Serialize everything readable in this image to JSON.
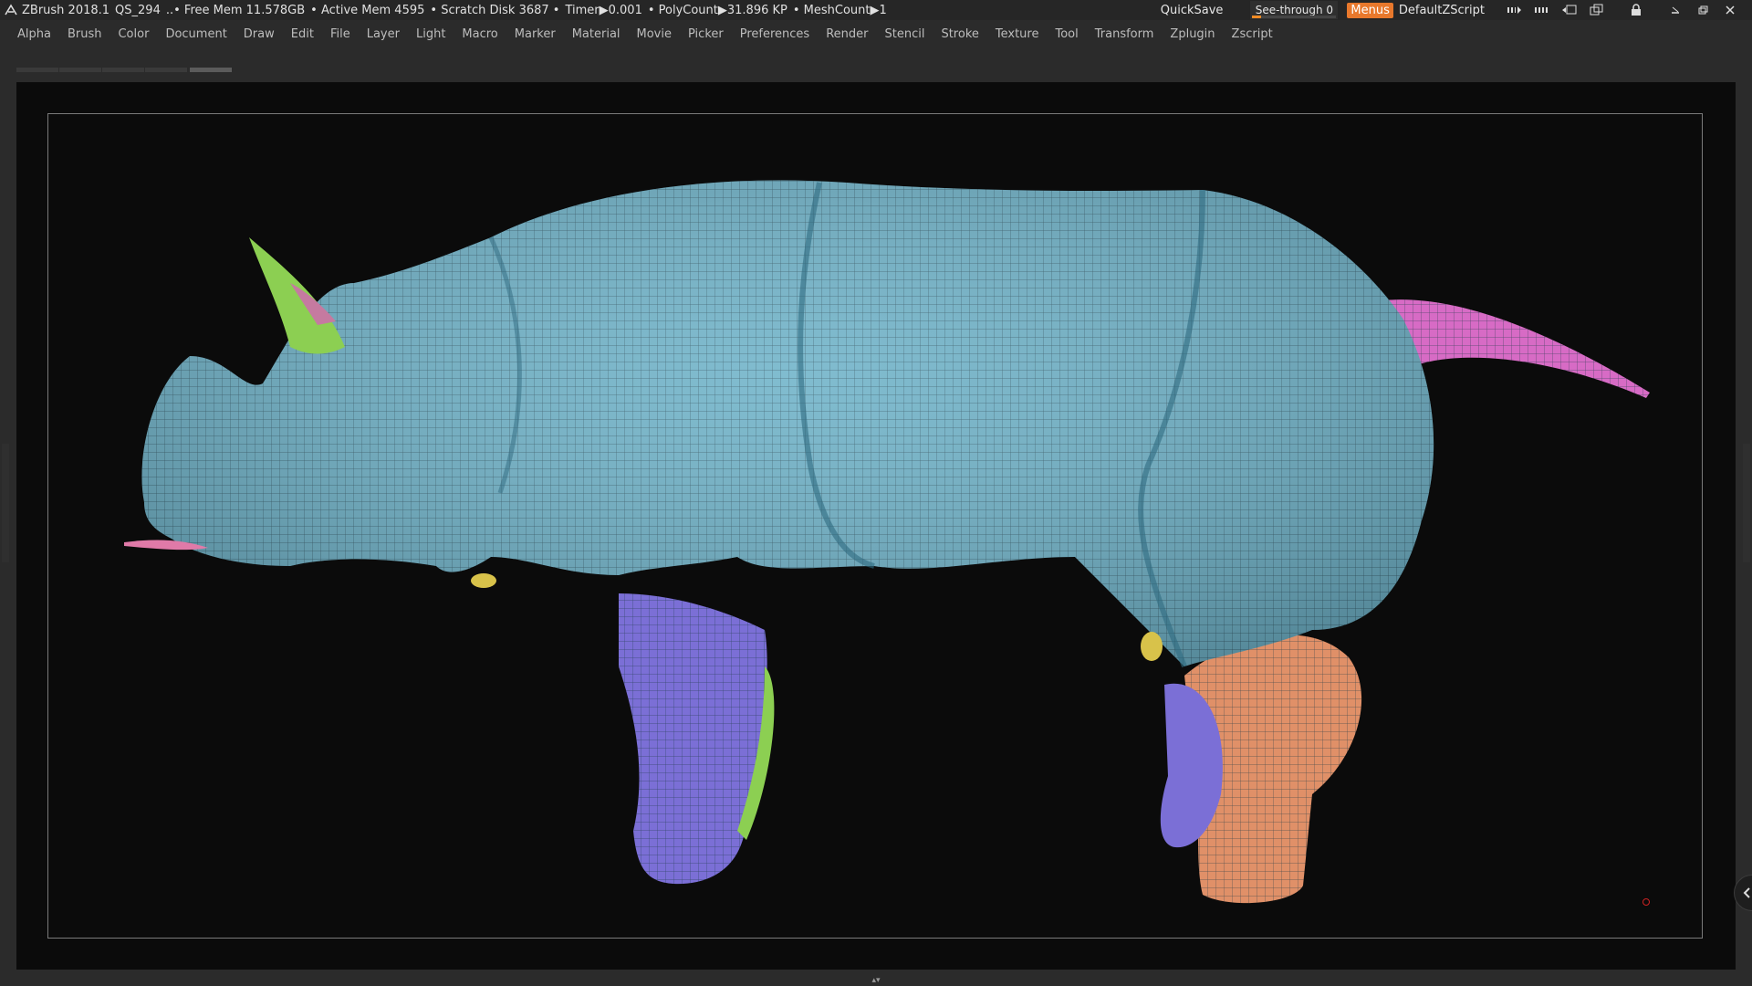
{
  "titlebar": {
    "app": "ZBrush 2018.1",
    "project": "QS_294",
    "free_mem": "..• Free Mem 11.578GB",
    "active_mem": "• Active Mem 4595",
    "scratch": "• Scratch Disk 3687 •",
    "timer": "Timer▶0.001",
    "polycount": "• PolyCount▶31.896 KP",
    "meshcount": "• MeshCount▶1",
    "quicksave": "QuickSave",
    "seethrough": "See-through  0",
    "seethrough_value": 0,
    "menus": "Menus",
    "defaultzscript": "DefaultZScript"
  },
  "menubar": {
    "items": [
      "Alpha",
      "Brush",
      "Color",
      "Document",
      "Draw",
      "Edit",
      "File",
      "Layer",
      "Light",
      "Macro",
      "Marker",
      "Material",
      "Movie",
      "Picker",
      "Preferences",
      "Render",
      "Stencil",
      "Stroke",
      "Texture",
      "Tool",
      "Transform",
      "Zplugin",
      "Zscript"
    ]
  },
  "colors": {
    "body": "#6fb3c9",
    "horn": "#8ccf52",
    "tail": "#d76bc5",
    "front_leg": "#7b6fd6",
    "rear_leg": "#e09068",
    "mouth": "#e07aa8"
  },
  "icons": {
    "bottom_handle": "▴▾"
  }
}
